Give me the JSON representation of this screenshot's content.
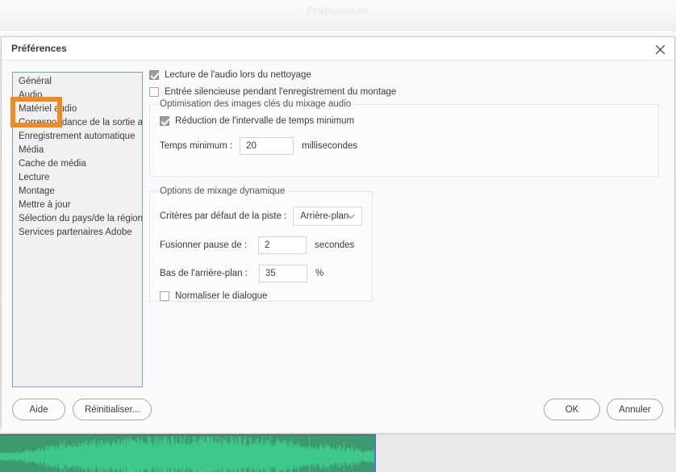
{
  "background_window": {
    "title": "Preferences"
  },
  "dialog": {
    "title": "Préférences",
    "close_icon": "close-icon"
  },
  "sidebar": {
    "items": [
      {
        "label": "Général"
      },
      {
        "label": "Audio"
      },
      {
        "label": "Matériel audio"
      },
      {
        "label": "Correspondance de la sortie audio"
      },
      {
        "label": "Enregistrement automatique"
      },
      {
        "label": "Média"
      },
      {
        "label": "Cache de média"
      },
      {
        "label": "Lecture"
      },
      {
        "label": "Montage"
      },
      {
        "label": "Mettre à jour"
      },
      {
        "label": "Sélection du pays/de la région"
      },
      {
        "label": "Services partenaires Adobe"
      }
    ],
    "highlight": {
      "target": "Audio",
      "color": "#f08c1f"
    }
  },
  "settings": {
    "checkbox_playback_scrub": {
      "label": "Lecture de l'audio lors du nettoyage",
      "checked": true
    },
    "checkbox_mute_input": {
      "label": "Entrée silencieuse pendant l'enregistrement du montage",
      "checked": false
    },
    "group_keyframe": {
      "title": "Optimisation des images clés du mixage audio",
      "checkbox_reduce_interval": {
        "label": "Réduction de l'intervalle de temps minimum",
        "checked": true
      },
      "min_time_label": "Temps minimum :",
      "min_time_value": "20",
      "min_time_unit": "millisecondes"
    },
    "group_dynamic": {
      "title": "Options de mixage dynamique",
      "track_criteria_label": "Critères par défaut de la piste :",
      "track_criteria_value": "Arrière-plan",
      "track_criteria_chevron": "chevron-down-icon",
      "merge_pause_label": "Fusionner pause de :",
      "merge_pause_value": "2",
      "merge_pause_unit": "secondes",
      "background_low_label": "Bas de l'arrière-plan :",
      "background_low_value": "35",
      "background_low_unit": "%",
      "checkbox_normalize_dialogue": {
        "label": "Normaliser le dialogue",
        "checked": false
      }
    }
  },
  "footer": {
    "help_label": "Aide",
    "reset_label": "Réinitialiser...",
    "ok_label": "OK",
    "cancel_label": "Annuler"
  },
  "timeline": {
    "waveform_color": "#3ec98b",
    "clip_color": "#3d9970",
    "playhead_color": "#4a6fd0"
  }
}
